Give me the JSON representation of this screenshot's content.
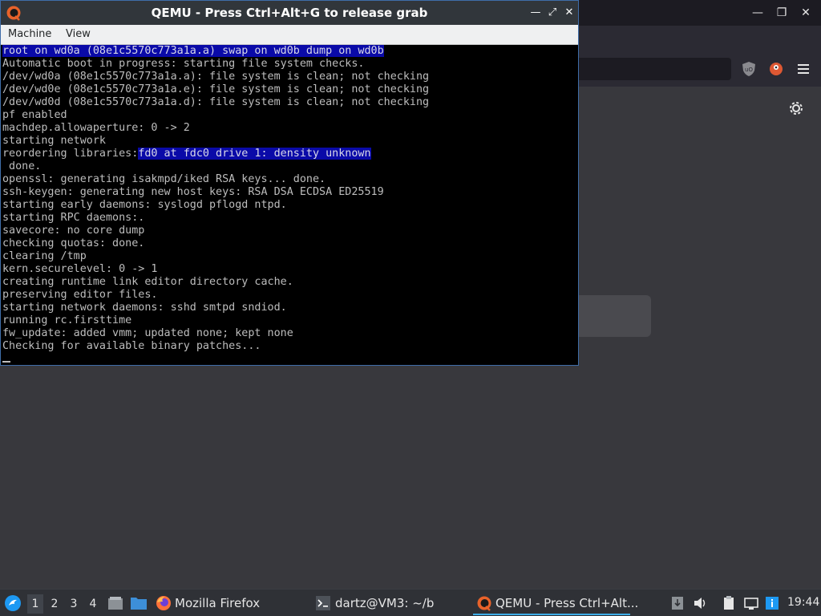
{
  "qemu": {
    "title": "QEMU - Press Ctrl+Alt+G to release grab",
    "menu": [
      "Machine",
      "View"
    ],
    "console": [
      {
        "text": "root on wd0a (08e1c5570c773a1a.a) swap on wd0b dump on wd0b",
        "highlight": true
      },
      {
        "text": "Automatic boot in progress: starting file system checks."
      },
      {
        "text": "/dev/wd0a (08e1c5570c773a1a.a): file system is clean; not checking"
      },
      {
        "text": "/dev/wd0e (08e1c5570c773a1a.e): file system is clean; not checking"
      },
      {
        "text": "/dev/wd0d (08e1c5570c773a1a.d): file system is clean; not checking"
      },
      {
        "text": "pf enabled"
      },
      {
        "text": "machdep.allowaperture: 0 -> 2"
      },
      {
        "text": "starting network"
      },
      {
        "text": "reordering libraries:",
        "suffix_hl": "fd0 at fdc0 drive 1: density unknown"
      },
      {
        "text": " done."
      },
      {
        "text": "openssl: generating isakmpd/iked RSA keys... done."
      },
      {
        "text": "ssh-keygen: generating new host keys: RSA DSA ECDSA ED25519"
      },
      {
        "text": "starting early daemons: syslogd pflogd ntpd."
      },
      {
        "text": "starting RPC daemons:."
      },
      {
        "text": "savecore: no core dump"
      },
      {
        "text": "checking quotas: done."
      },
      {
        "text": "clearing /tmp"
      },
      {
        "text": "kern.securelevel: 0 -> 1"
      },
      {
        "text": "creating runtime link editor directory cache."
      },
      {
        "text": "preserving editor files."
      },
      {
        "text": "starting network daemons: sshd smtpd sndiod."
      },
      {
        "text": "running rc.firsttime"
      },
      {
        "text": "fw_update: added vmm; updated none; kept none"
      },
      {
        "text": "Checking for available binary patches..."
      }
    ]
  },
  "taskbar": {
    "workspaces": [
      "1",
      "2",
      "3",
      "4"
    ],
    "active_workspace": "1",
    "tasks": {
      "firefox": "Mozilla Firefox",
      "terminal": "dartz@VM3: ~/b",
      "qemu": "QEMU - Press Ctrl+Alt..."
    },
    "clock": "19:44"
  },
  "icons": {
    "qemu_logo": "qemu-logo-icon",
    "start": "start-menu-icon",
    "firefox": "firefox-icon",
    "terminal": "terminal-icon",
    "settings": "gear-icon"
  },
  "colors": {
    "console_highlight": "#0a0aa8",
    "active_task_underline": "#3daee9"
  }
}
